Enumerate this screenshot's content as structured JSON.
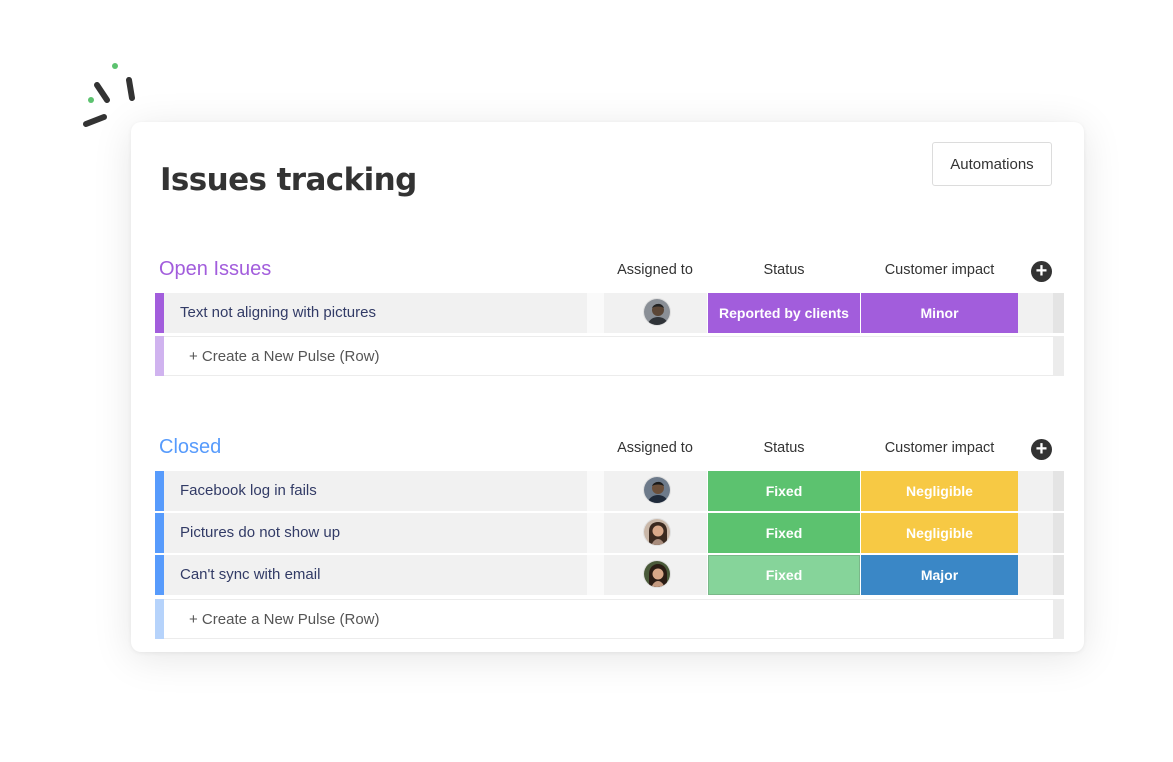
{
  "board": {
    "title": "Issues tracking",
    "automations_label": "Automations"
  },
  "columns": {
    "assigned": "Assigned to",
    "status": "Status",
    "impact": "Customer impact"
  },
  "groups": [
    {
      "title": "Open Issues",
      "color": "#a25ddc",
      "new_row_color": "#d0b3ef",
      "rows": [
        {
          "name": "Text not aligning with pictures",
          "status": "Reported by clients",
          "status_color": "#a25ddc",
          "impact": "Minor",
          "impact_color": "#a25ddc"
        }
      ],
      "new_row_label": "+ Create a New Pulse (Row)"
    },
    {
      "title": "Closed",
      "color": "#579bfc",
      "new_row_color": "#b6d3fb",
      "rows": [
        {
          "name": "Facebook log in fails",
          "status": "Fixed",
          "status_color": "#5cc26f",
          "impact": "Negligible",
          "impact_color": "#f7c944"
        },
        {
          "name": "Pictures do not show up",
          "status": "Fixed",
          "status_color": "#5cc26f",
          "impact": "Negligible",
          "impact_color": "#f7c944"
        },
        {
          "name": "Can't sync with email",
          "status": "Fixed",
          "status_color": "#86d49a",
          "impact": "Major",
          "impact_color": "#3a87c6"
        }
      ],
      "new_row_label": "+ Create a New Pulse (Row)"
    }
  ],
  "icons": {
    "add_column": "plus-circle-icon",
    "logo_sparkle": "sparkle-icon"
  }
}
